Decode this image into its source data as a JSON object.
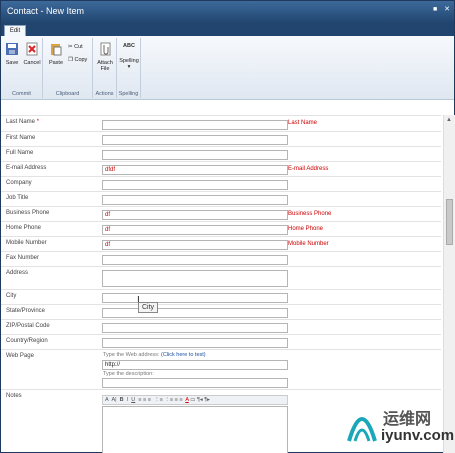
{
  "window": {
    "title": "Contact - New Item",
    "controls": [
      "■",
      "✕"
    ]
  },
  "tabs": [
    {
      "label": "Edit"
    }
  ],
  "ribbon": {
    "commit": {
      "name": "Commit",
      "save": "Save",
      "cancel": "Cancel"
    },
    "clipboard": {
      "name": "Clipboard",
      "paste": "Paste",
      "cut": "Cut",
      "copy": "Copy"
    },
    "actions": {
      "name": "Actions",
      "attach_line1": "Attach",
      "attach_line2": "File"
    },
    "spelling": {
      "name": "Spelling",
      "label": "Spelling",
      "icon_text": "ABC"
    }
  },
  "form": {
    "fields": [
      {
        "label": "Last Name",
        "required": "*",
        "value": "",
        "error": "Last Name"
      },
      {
        "label": "First Name",
        "value": "",
        "error": ""
      },
      {
        "label": "Full Name",
        "value": "",
        "error": ""
      },
      {
        "label": "E-mail Address",
        "value": "dfdf",
        "error": "E-mail Address"
      },
      {
        "label": "Company",
        "value": "",
        "error": ""
      },
      {
        "label": "Job Title",
        "value": "",
        "error": ""
      },
      {
        "label": "Business Phone",
        "value": "df",
        "error": "Business Phone"
      },
      {
        "label": "Home Phone",
        "value": "df",
        "error": "Home Phone"
      },
      {
        "label": "Mobile Number",
        "value": "df",
        "error": "Mobile Number"
      },
      {
        "label": "Fax Number",
        "value": "",
        "error": ""
      }
    ],
    "address_label": "Address",
    "city_label": "City",
    "more_fields": [
      {
        "label": "State/Province"
      },
      {
        "label": "ZIP/Postal Code"
      },
      {
        "label": "Country/Region"
      }
    ],
    "web_page": {
      "label": "Web Page",
      "hint": "Type the Web address:",
      "link": "(Click here to test)",
      "url_value": "http://",
      "desc_hint": "Type the description:"
    },
    "notes_label": "Notes",
    "toolbar_glyphs": [
      "A",
      "A|",
      "B",
      "I",
      "U",
      "≡",
      "≡",
      "≡",
      "⋮≡",
      "⋮≡",
      "≡",
      "≡",
      "A",
      "▭",
      "¶◂",
      "¶▸"
    ]
  },
  "tooltip": "City",
  "watermark": {
    "line1": "运维网",
    "line2": "iyunv.com"
  },
  "colors": {
    "titlebar": "#21456f",
    "error": "#cc0000",
    "link": "#1a4fa0"
  }
}
